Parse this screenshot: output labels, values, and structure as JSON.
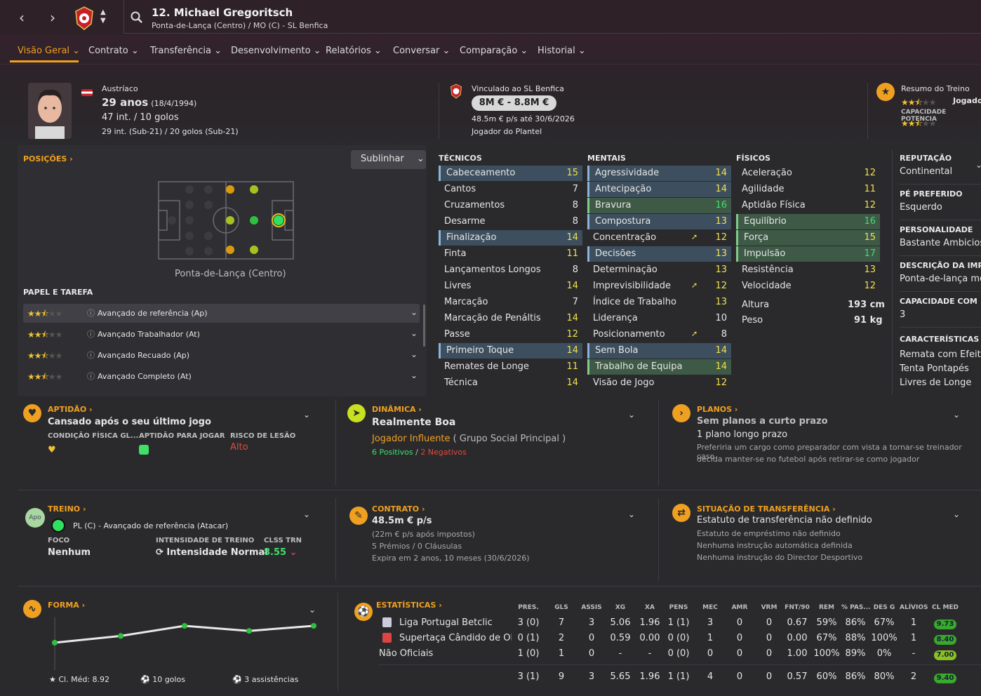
{
  "header": {
    "name": "12. Michael Gregoritsch",
    "subtitle": "Ponta-de-Lança (Centro) / MO (C) - SL Benfica"
  },
  "tabs": [
    {
      "label": "Visão Geral"
    },
    {
      "label": "Contrato"
    },
    {
      "label": "Transferência"
    },
    {
      "label": "Desenvolvimento"
    },
    {
      "label": "Relatórios"
    },
    {
      "label": "Conversar"
    },
    {
      "label": "Comparação"
    },
    {
      "label": "Historial"
    }
  ],
  "profile": {
    "nationality": "Austríaco",
    "age": "29 anos",
    "dob": "(18/4/1994)",
    "caps": "47 int. / 10 golos",
    "youth_caps": "29 int. (Sub-21) / 20 golos (Sub-21)"
  },
  "club": {
    "label": "Vinculado ao SL Benfica",
    "value": "8M € - 8.8M €",
    "wage": "48.5m € p/s até 30/6/2026",
    "status": "Jogador do Plantel"
  },
  "training_summary": {
    "title": "Resumo do Treino",
    "label1": "Jogado",
    "label2": "CAPACIDADE POTENCIA",
    "rating1": 2.5,
    "rating2": 2.5
  },
  "positions": {
    "title": "POSIÇÕES",
    "highlight_btn": "Sublinhar",
    "position_label": "Ponta-de-Lança (Centro)"
  },
  "roles": {
    "title": "PAPEL E TAREFA",
    "items": [
      {
        "label": "Avançado de referência (Ap)",
        "stars": 2.5
      },
      {
        "label": "Avançado Trabalhador (At)",
        "stars": 2.5
      },
      {
        "label": "Avançado Recuado (Ap)",
        "stars": 2.5
      },
      {
        "label": "Avançado Completo (At)",
        "stars": 2.5
      }
    ]
  },
  "technical": {
    "title": "TÉCNICOS",
    "items": [
      {
        "name": "Cabeceamento",
        "value": "15"
      },
      {
        "name": "Cantos",
        "value": "7"
      },
      {
        "name": "Cruzamentos",
        "value": "8"
      },
      {
        "name": "Desarme",
        "value": "8"
      },
      {
        "name": "Finalização",
        "value": "14"
      },
      {
        "name": "Finta",
        "value": "11"
      },
      {
        "name": "Lançamentos Longos",
        "value": "8"
      },
      {
        "name": "Livres",
        "value": "14"
      },
      {
        "name": "Marcação",
        "value": "7"
      },
      {
        "name": "Marcação de Penáltis",
        "value": "14"
      },
      {
        "name": "Passe",
        "value": "12"
      },
      {
        "name": "Primeiro Toque",
        "value": "14"
      },
      {
        "name": "Remates de Longe",
        "value": "11"
      },
      {
        "name": "Técnica",
        "value": "14"
      }
    ]
  },
  "mental": {
    "title": "MENTAIS",
    "items": [
      {
        "name": "Agressividade",
        "value": "14"
      },
      {
        "name": "Antecipação",
        "value": "14"
      },
      {
        "name": "Bravura",
        "value": "16"
      },
      {
        "name": "Compostura",
        "value": "13"
      },
      {
        "name": "Concentração",
        "value": "12"
      },
      {
        "name": "Decisões",
        "value": "13"
      },
      {
        "name": "Determinação",
        "value": "13"
      },
      {
        "name": "Imprevisibilidade",
        "value": "12"
      },
      {
        "name": "Índice de Trabalho",
        "value": "13"
      },
      {
        "name": "Liderança",
        "value": "10"
      },
      {
        "name": "Posicionamento",
        "value": "8"
      },
      {
        "name": "Sem Bola",
        "value": "14"
      },
      {
        "name": "Trabalho de Equipa",
        "value": "14"
      },
      {
        "name": "Visão de Jogo",
        "value": "12"
      }
    ]
  },
  "physical": {
    "title": "FÍSICOS",
    "items": [
      {
        "name": "Aceleração",
        "value": "12"
      },
      {
        "name": "Agilidade",
        "value": "11"
      },
      {
        "name": "Aptidão Física",
        "value": "12"
      },
      {
        "name": "Equilíbrio",
        "value": "16"
      },
      {
        "name": "Força",
        "value": "15"
      },
      {
        "name": "Impulsão",
        "value": "17"
      },
      {
        "name": "Resistência",
        "value": "13"
      },
      {
        "name": "Velocidade",
        "value": "12"
      }
    ],
    "height_label": "Altura",
    "height": "193 cm",
    "weight_label": "Peso",
    "weight": "91 kg"
  },
  "info": [
    {
      "title": "REPUTAÇÃO",
      "lines": [
        "Continental"
      ]
    },
    {
      "title": "PÉ PREFERIDO",
      "lines": [
        "Esquerdo"
      ]
    },
    {
      "title": "PERSONALIDADE",
      "lines": [
        "Bastante Ambicioso"
      ]
    },
    {
      "title": "DESCRIÇÃO DA IMP",
      "lines": [
        "Ponta-de-lança móv"
      ]
    },
    {
      "title": "CAPACIDADE COM",
      "lines": [
        "3"
      ]
    },
    {
      "title": "CARACTERÍSTICAS",
      "lines": [
        "Remata com Efeito",
        "Tenta Pontapés",
        "Livres de Longe"
      ]
    }
  ],
  "aptidao": {
    "title": "APTIDÃO",
    "text": "Cansado após o seu último jogo",
    "col1": "CONDIÇÃO FÍSICA GL...",
    "col2": "APTIDÃO PARA JOGAR",
    "col3": "RISCO DE LESÃO",
    "risk": "Alto"
  },
  "dinamica": {
    "title": "DINÂMICA",
    "text": "Realmente Boa",
    "role": "Jogador Influente",
    "group": "( Grupo Social Principal )",
    "pos": "6 Positivos",
    "sep": "/",
    "neg": "2 Negativos"
  },
  "planos": {
    "title": "PLANOS",
    "short": "Sem planos a curto prazo",
    "long": "1 plano longo prazo",
    "desc1": "Preferiria um cargo como preparador com vista a tornar-se treinador caso",
    "desc2": "decida manter-se no futebol após retirar-se como jogador"
  },
  "treino": {
    "title": "TREINO",
    "badge": "Apo",
    "role": "PL (C) - Avançado de referência (Atacar)",
    "foco_label": "FOCO",
    "foco": "Nenhum",
    "int_label": "INTENSIDADE DE TREINO",
    "int": "Intensidade Normal",
    "clss_label": "CLSS TRN",
    "clss": "8.55"
  },
  "contrato": {
    "title": "CONTRATO",
    "wage": "48.5m € p/s",
    "net": "(22m € p/s após impostos)",
    "bonus": "5 Prémios / 0 Cláusulas",
    "expiry": "Expira em 2 anos, 10 meses  (30/6/2026)"
  },
  "transfer": {
    "title": "SITUAÇÃO DE TRANSFERÊNCIA",
    "status": "Estatuto de transferência não definido",
    "l1": "Estatuto de empréstimo não definido",
    "l2": "Nenhuma instrução automática definida",
    "l3": "Nenhuma instrução do Director Desportivo"
  },
  "forma": {
    "title": "FORMA",
    "avg": "Cl. Méd: 8.92",
    "goals": "10 golos",
    "assists": "3 assistências",
    "points": [
      6.5,
      6.9,
      7.5,
      7.2,
      7.5
    ]
  },
  "stats": {
    "title": "ESTATÍSTICAS",
    "headers": [
      "PRES.",
      "GLS",
      "ASSIS",
      "XG",
      "XA",
      "PENS",
      "MEC",
      "AMR",
      "VRM",
      "FNT/90",
      "REM",
      "% PAS...",
      "DES G",
      "ALÍVIOS",
      "CL MED"
    ],
    "rows": [
      {
        "comp": "Liga Portugal Betclic",
        "cells": [
          "3 (0)",
          "7",
          "3",
          "5.06",
          "1.96",
          "1 (1)",
          "3",
          "0",
          "0",
          "0.67",
          "59%",
          "86%",
          "67%",
          "1",
          "9.73"
        ]
      },
      {
        "comp": "Supertaça Cândido de Ol...",
        "cells": [
          "0 (1)",
          "2",
          "0",
          "0.59",
          "0.00",
          "0 (0)",
          "1",
          "0",
          "0",
          "0.00",
          "67%",
          "88%",
          "100%",
          "1",
          "8.40"
        ]
      },
      {
        "comp": "Não Oficiais",
        "cells": [
          "1 (0)",
          "1",
          "0",
          "-",
          "-",
          "0 (0)",
          "0",
          "0",
          "0",
          "1.00",
          "100%",
          "89%",
          "0%",
          "-",
          "7.00"
        ]
      }
    ],
    "total": [
      "3 (1)",
      "9",
      "3",
      "5.65",
      "1.96",
      "1 (1)",
      "4",
      "0",
      "0",
      "0.57",
      "60%",
      "86%",
      "80%",
      "2",
      "9.40"
    ]
  },
  "colors": {
    "accent": "#f0a020",
    "green": "#3ee06a",
    "yellow": "#f2e04b"
  }
}
